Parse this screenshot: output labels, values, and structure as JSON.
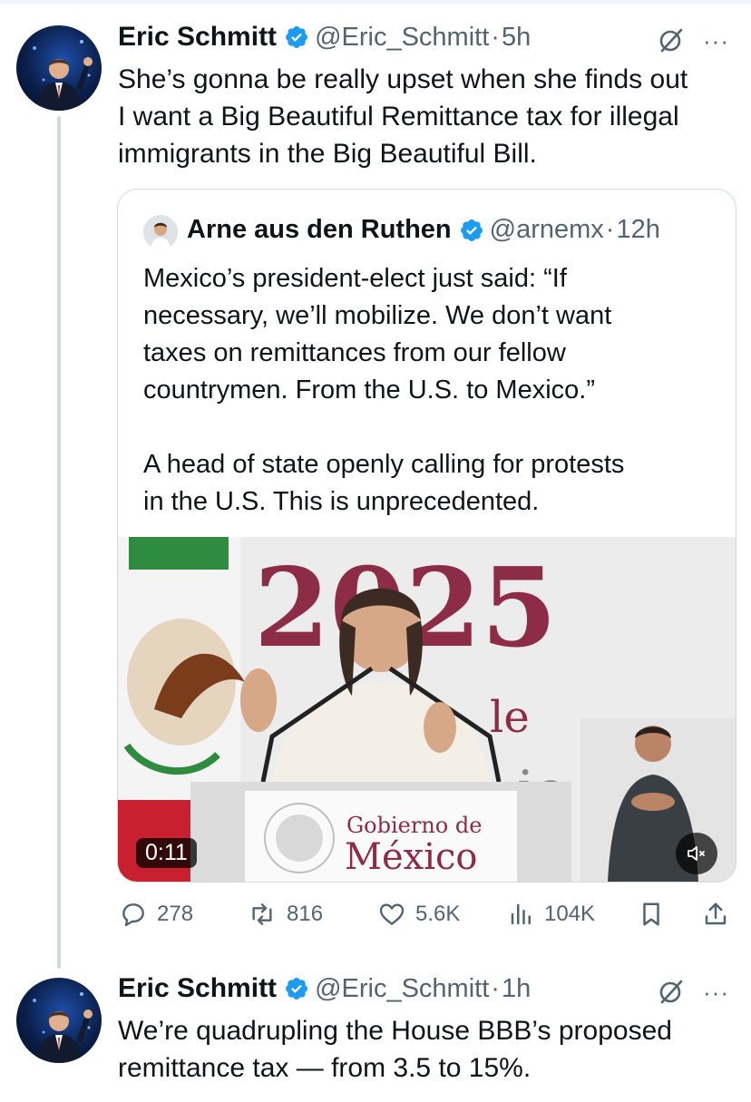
{
  "tweets": [
    {
      "name": "Eric Schmitt",
      "handle": "@Eric_Schmitt",
      "time": "5h",
      "lines": [
        "She’s gonna be really upset when she finds out",
        "I want a Big Beautiful Remittance tax for illegal",
        "immigrants in the Big Beautiful Bill."
      ],
      "more": "···"
    },
    {
      "name": "Eric Schmitt",
      "handle": "@Eric_Schmitt",
      "time": "1h",
      "lines": [
        "We’re quadrupling the House BBB’s proposed",
        "remittance tax — from 3.5 to 15%."
      ],
      "more": "···"
    }
  ],
  "quote": {
    "name": "Arne aus den Ruthen",
    "handle": "@arnemx",
    "time": "12h",
    "paragraph1": [
      "Mexico’s president-elect just said: “If",
      "necessary, we’ll mobilize. We don’t want",
      "taxes on remittances from our fellow",
      "countrymen. From the U.S. to Mexico.”"
    ],
    "paragraph2": [
      "A head of state openly calling for protests",
      "in the U.S. This is unprecedented."
    ],
    "video": {
      "duration": "0:11",
      "banner_year": "2025",
      "banner_fragments": [
        "le",
        "ie"
      ],
      "podium_line1": "Gobierno de",
      "podium_line2": "México"
    }
  },
  "actions": {
    "replies": "278",
    "reposts": "816",
    "likes": "5.6K",
    "views": "104K"
  },
  "colors": {
    "verified": "#1d9bf0",
    "secondary_text": "#536471",
    "border": "#cfd9de",
    "banner_maroon": "#8c2c46"
  }
}
